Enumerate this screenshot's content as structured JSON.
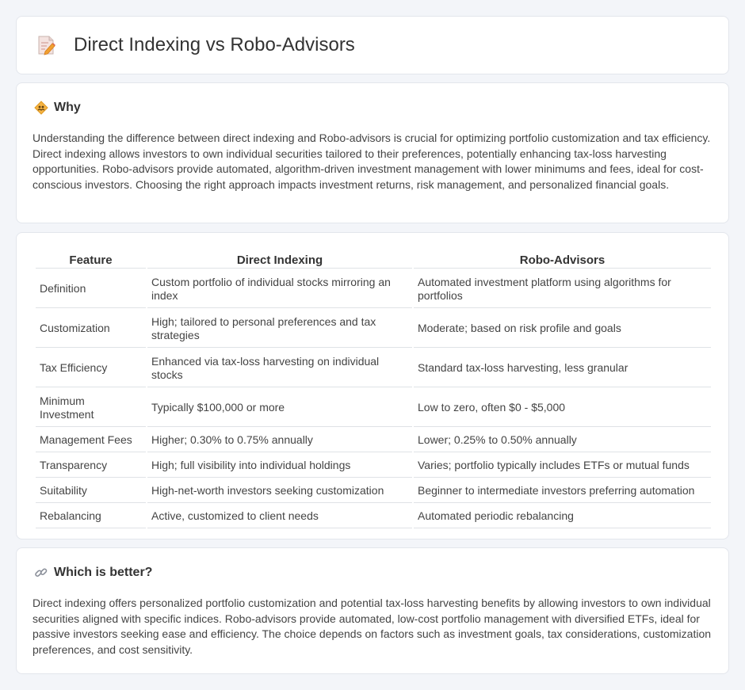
{
  "header": {
    "title": "Direct Indexing vs Robo-Advisors",
    "icon": "document-edit-icon"
  },
  "why": {
    "title": "Why",
    "icon": "diamond-people-icon",
    "text": "Understanding the difference between direct indexing and Robo-advisors is crucial for optimizing portfolio customization and tax efficiency. Direct indexing allows investors to own individual securities tailored to their preferences, potentially enhancing tax-loss harvesting opportunities. Robo-advisors provide automated, algorithm-driven investment management with lower minimums and fees, ideal for cost-conscious investors. Choosing the right approach impacts investment returns, risk management, and personalized financial goals."
  },
  "table": {
    "headers": [
      "Feature",
      "Direct Indexing",
      "Robo-Advisors"
    ],
    "rows": [
      [
        "Definition",
        "Custom portfolio of individual stocks mirroring an index",
        "Automated investment platform using algorithms for portfolios"
      ],
      [
        "Customization",
        "High; tailored to personal preferences and tax strategies",
        "Moderate; based on risk profile and goals"
      ],
      [
        "Tax Efficiency",
        "Enhanced via tax-loss harvesting on individual stocks",
        "Standard tax-loss harvesting, less granular"
      ],
      [
        "Minimum Investment",
        "Typically $100,000 or more",
        "Low to zero, often $0 - $5,000"
      ],
      [
        "Management Fees",
        "Higher; 0.30% to 0.75% annually",
        "Lower; 0.25% to 0.50% annually"
      ],
      [
        "Transparency",
        "High; full visibility into individual holdings",
        "Varies; portfolio typically includes ETFs or mutual funds"
      ],
      [
        "Suitability",
        "High-net-worth investors seeking customization",
        "Beginner to intermediate investors preferring automation"
      ],
      [
        "Rebalancing",
        "Active, customized to client needs",
        "Automated periodic rebalancing"
      ]
    ]
  },
  "better": {
    "title": "Which is better?",
    "icon": "link-icon",
    "text": "Direct indexing offers personalized portfolio customization and potential tax-loss harvesting benefits by allowing investors to own individual securities aligned with specific indices. Robo-advisors provide automated, low-cost portfolio management with diversified ETFs, ideal for passive investors seeking ease and efficiency. The choice depends on factors such as investment goals, tax considerations, customization preferences, and cost sensitivity."
  },
  "colors": {
    "background": "#f3f5f9",
    "card": "#ffffff",
    "border": "#e3e6ec",
    "accent_orange": "#f0a030",
    "icon_pink": "#e06a5a"
  }
}
